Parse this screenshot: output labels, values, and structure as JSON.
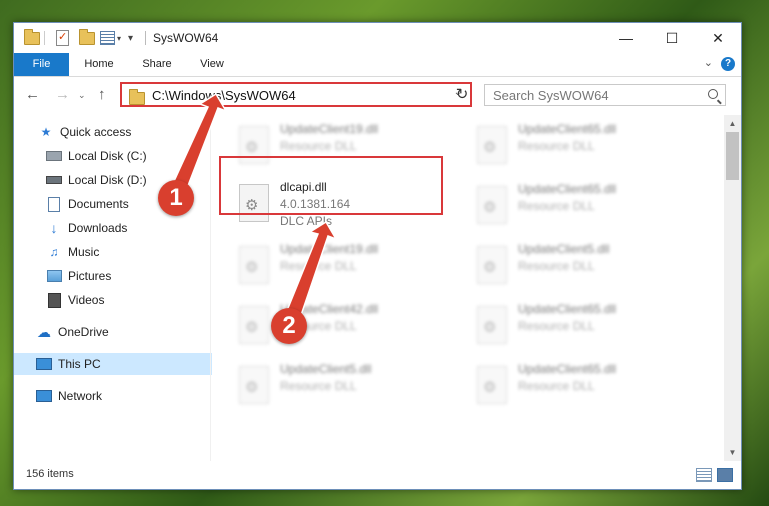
{
  "window": {
    "title": "SysWOW64",
    "controls": {
      "minimize": "—",
      "maximize": "☐",
      "close": "✕"
    }
  },
  "ribbon": {
    "tabs": [
      "File",
      "Home",
      "Share",
      "View"
    ],
    "help": "?"
  },
  "address": {
    "path": "C:\\Windows\\SysWOW64",
    "search_placeholder": "Search SysWOW64"
  },
  "sidebar": {
    "items": [
      {
        "label": "Quick access",
        "icon": "star-icon"
      },
      {
        "label": "Local Disk (C:)",
        "icon": "drive-icon",
        "pinned": true
      },
      {
        "label": "Local Disk (D:)",
        "icon": "drive-icon",
        "pinned": true
      },
      {
        "label": "Documents",
        "icon": "documents-icon",
        "pinned": true
      },
      {
        "label": "Downloads",
        "icon": "download-arrow-icon",
        "pinned": true
      },
      {
        "label": "Music",
        "icon": "music-icon",
        "pinned": true
      },
      {
        "label": "Pictures",
        "icon": "pictures-icon",
        "pinned": true
      },
      {
        "label": "Videos",
        "icon": "film-icon",
        "pinned": true
      },
      {
        "label": "OneDrive",
        "icon": "cloud-icon"
      },
      {
        "label": "This PC",
        "icon": "monitor-icon",
        "selected": true
      },
      {
        "label": "Network",
        "icon": "network-icon"
      }
    ]
  },
  "files": {
    "featured": {
      "name": "dlcapi.dll",
      "version": "4.0.1381.164",
      "description": "DLC APIs"
    },
    "left_column": [
      {
        "name": "UpdateClient19.dll",
        "type": "Resource DLL"
      },
      {
        "name": "UpdateClient19.dll",
        "type": "Resource DLL"
      },
      {
        "name": "UpdateClient42.dll",
        "type": "Resource DLL"
      },
      {
        "name": "UpdateClient5.dll",
        "type": "Resource DLL"
      }
    ],
    "right_column": [
      {
        "name": "UpdateClient65.dll",
        "type": "Resource DLL"
      },
      {
        "name": "UpdateClient65.dll",
        "type": "Resource DLL"
      },
      {
        "name": "UpdateClient5.dll",
        "type": "Resource DLL"
      },
      {
        "name": "UpdateClient65.dll",
        "type": "Resource DLL"
      },
      {
        "name": "UpdateClient65.dll",
        "type": "Resource DLL"
      }
    ]
  },
  "status": {
    "item_count": "156 items"
  },
  "annotations": {
    "step1": "1",
    "step2": "2"
  },
  "colors": {
    "accent": "#1979ca",
    "highlight": "#d9383a",
    "marker": "#d93f2e",
    "selection": "#cce8ff"
  }
}
